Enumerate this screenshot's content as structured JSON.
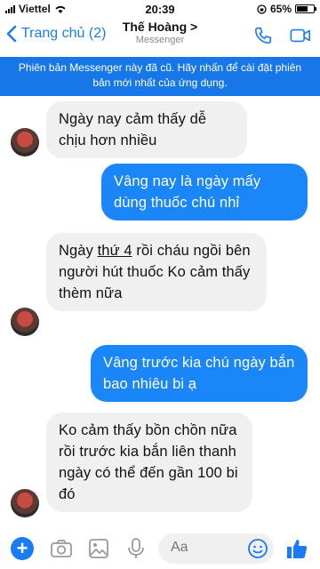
{
  "status_bar": {
    "carrier": "Viettel",
    "time": "20:39",
    "battery": "65%",
    "battery_level": 0.65
  },
  "header": {
    "back_label": "Trang chủ (2)",
    "title": "Thế Hoàng >",
    "subtitle": "Messenger"
  },
  "banner": {
    "text": "Phiên bản Messenger này đã cũ. Hãy nhấn để cài đặt phiên bản mới nhất của ứng dụng."
  },
  "messages": [
    {
      "side": "in",
      "text": "Ngày nay cảm thấy dễ chịu hơn nhiều"
    },
    {
      "side": "out",
      "text": "Vâng nay là ngày mấy dùng thuốc chú nhỉ"
    },
    {
      "side": "in",
      "pre": "Ngày ",
      "underlined": "thứ 4",
      "post": " rồi cháu ngồi bên người hút thuốc Ko cảm thấy thèm nữa"
    },
    {
      "side": "out",
      "text": "Vâng trước kia chú ngày bắn bao nhiêu bi ạ"
    },
    {
      "side": "in",
      "text": "Ko cảm thấy bồn chồn nữa rồi trước kia bắn liên thanh ngày có thể đến gần 100 bi đó"
    }
  ],
  "composer": {
    "placeholder": "Aa"
  },
  "icons": [
    "plus-icon",
    "camera-icon",
    "image-icon",
    "microphone-icon",
    "emoji-icon",
    "like-icon",
    "phone-icon",
    "video-icon",
    "chevron-left-icon"
  ]
}
